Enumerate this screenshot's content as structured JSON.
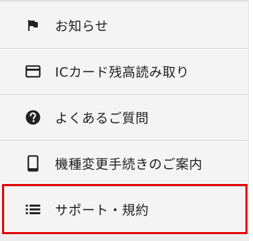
{
  "menu": {
    "items": [
      {
        "label": "お知らせ",
        "icon": "flag-icon"
      },
      {
        "label": "ICカード残高読み取り",
        "icon": "card-icon"
      },
      {
        "label": "よくあるご質問",
        "icon": "help-circle-icon"
      },
      {
        "label": "機種変更手続きのご案内",
        "icon": "phone-icon"
      },
      {
        "label": "サポート・規約",
        "icon": "list-icon"
      }
    ],
    "highlight_color": "#e30000",
    "text_color": "#1f1f1f",
    "background_color": "#f4f4f4"
  }
}
